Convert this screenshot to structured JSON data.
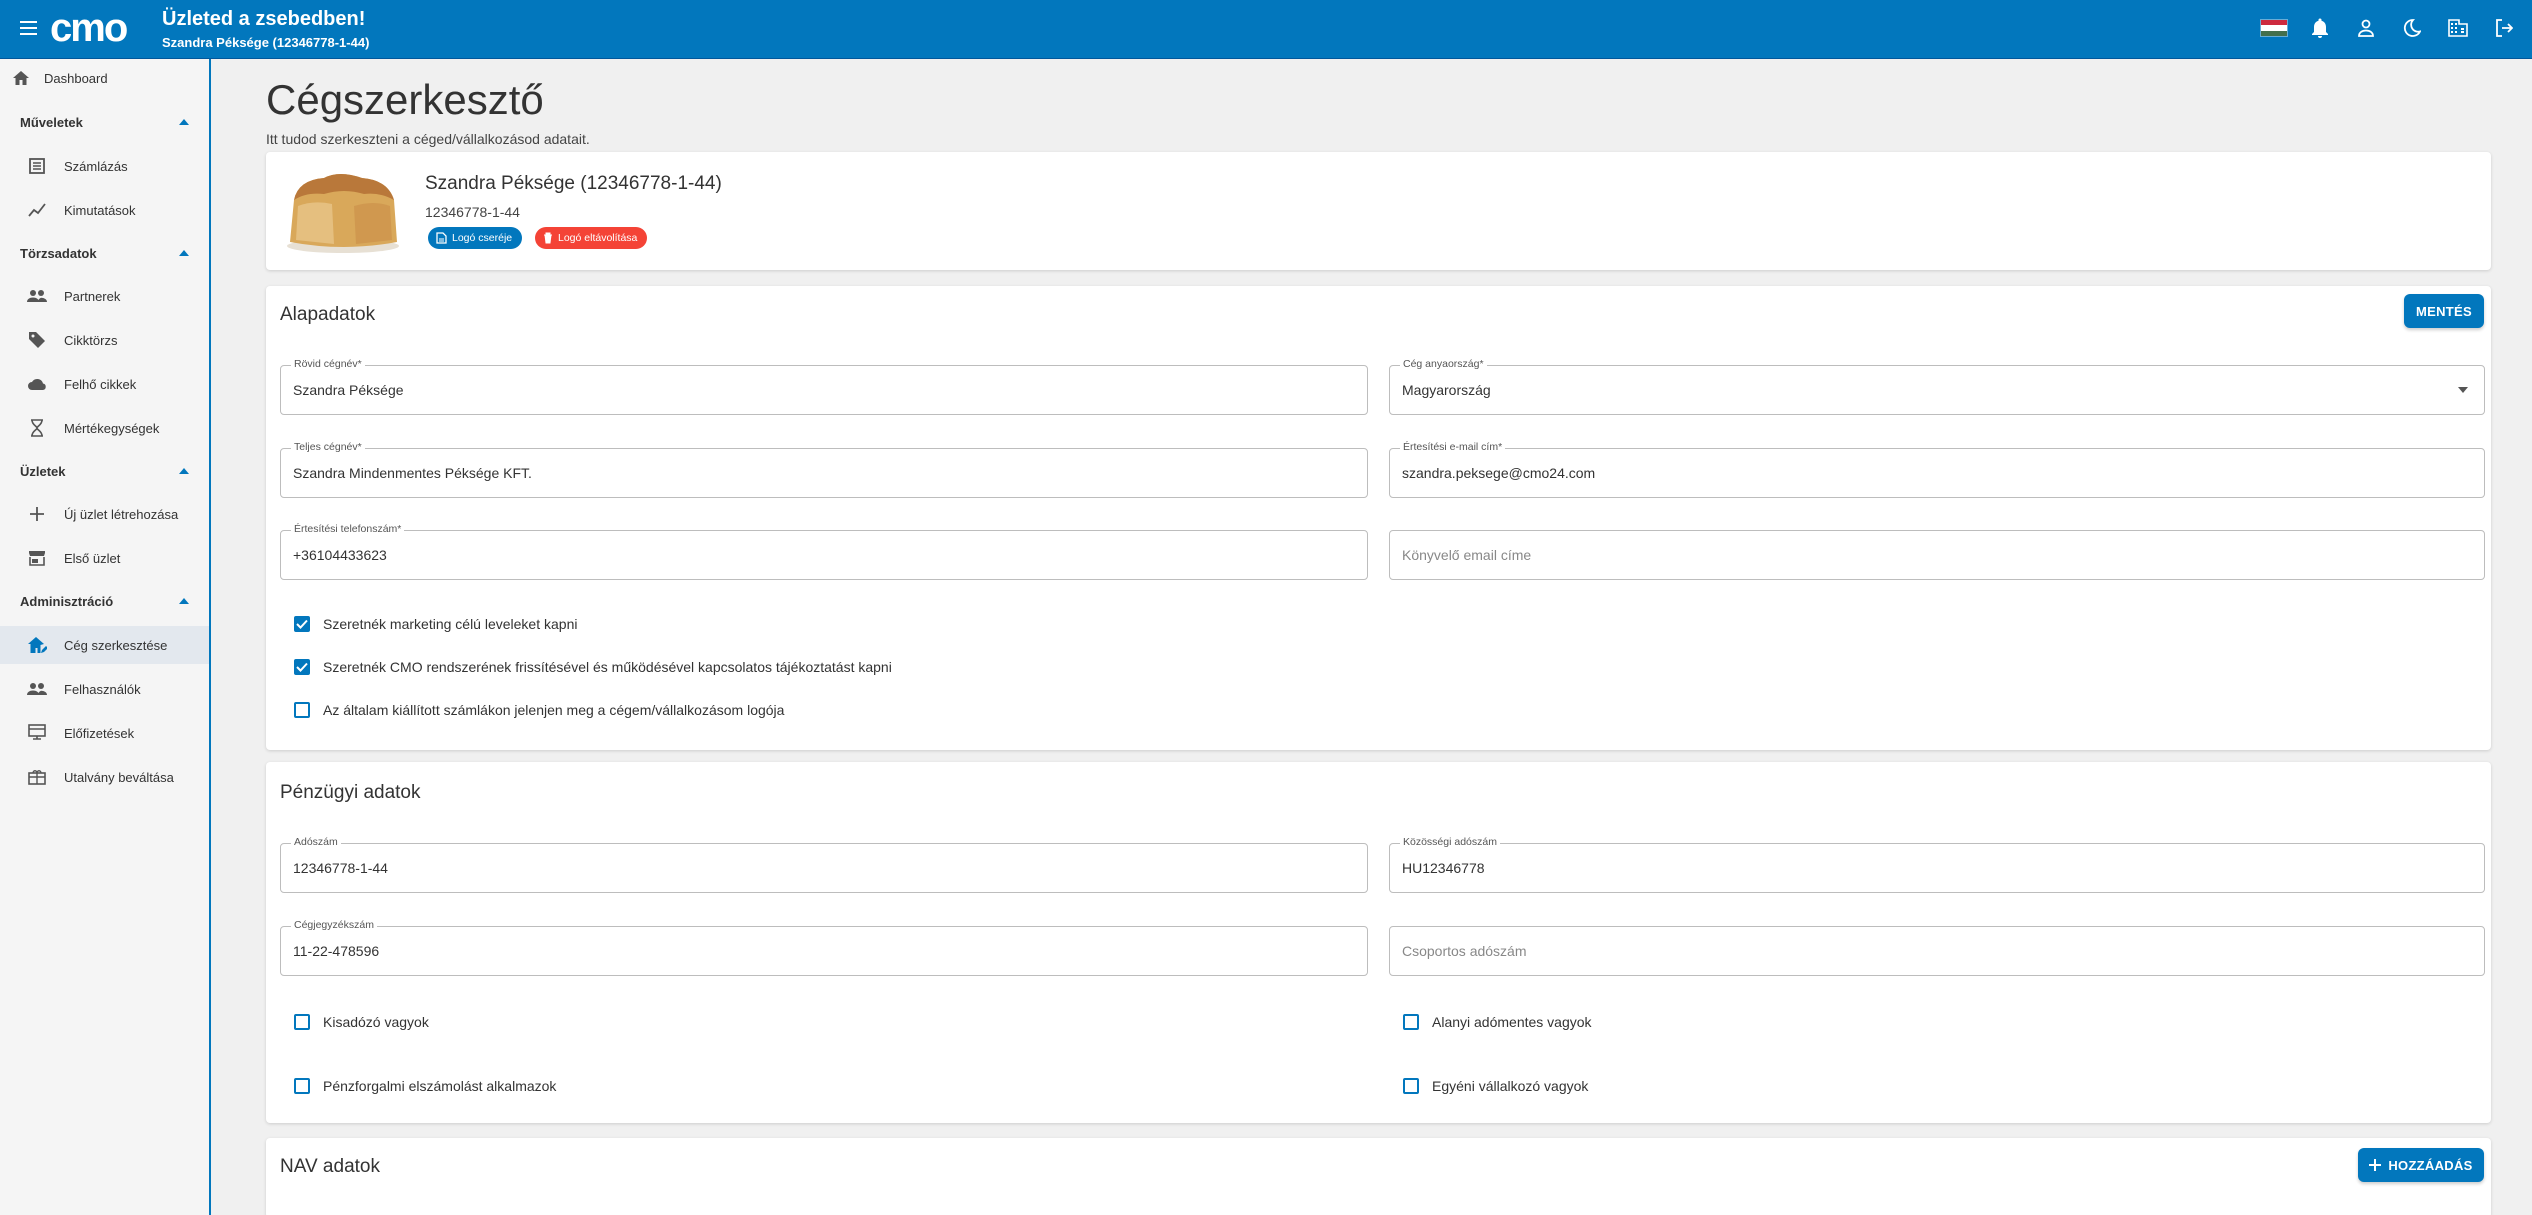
{
  "header": {
    "logo_text": "cmo",
    "shop_title": "Üzleted a zsebedben!",
    "shop_subtitle": "Szandra Péksége (12346778-1-44)",
    "flag_colors": [
      "#cd2a3e",
      "#ffffff",
      "#436f4d"
    ]
  },
  "sidebar": {
    "dashboard": "Dashboard",
    "sections": {
      "muveletek": "Műveletek",
      "torzsadatok": "Törzsadatok",
      "uzletek": "Üzletek",
      "adminisztracio": "Adminisztráció"
    },
    "items": {
      "szamlazas": "Számlázás",
      "kimutatasok": "Kimutatások",
      "partnerek": "Partnerek",
      "cikktorzs": "Cikktörzs",
      "felho_cikkek": "Felhő cikkek",
      "mertekegysegek": "Mértékegységek",
      "uj_uzlet": "Új üzlet létrehozása",
      "elso_uzlet": "Első üzlet",
      "ceg_szerkesztese": "Cég szerkesztése",
      "felhasznalok": "Felhasználók",
      "elofizetesek": "Előfizetések",
      "utalvany": "Utalvány beváltása"
    }
  },
  "page": {
    "title": "Cégszerkesztő",
    "description": "Itt tudod szerkeszteni a céged/vállalkozásod adatait."
  },
  "company_card": {
    "name": "Szandra Péksége (12346778-1-44)",
    "tax_number": "12346778-1-44",
    "change_logo": "Logó cseréje",
    "remove_logo": "Logó eltávolítása"
  },
  "basic": {
    "title": "Alapadatok",
    "save": "MENTÉS",
    "short_name_label": "Rövid cégnév*",
    "short_name": "Szandra Péksége",
    "country_label": "Cég anyaország*",
    "country": "Magyarország",
    "full_name_label": "Teljes cégnév*",
    "full_name": "Szandra Mindenmentes Péksége KFT.",
    "email_label": "Értesítési e-mail cím*",
    "email": "szandra.peksege@cmo24.com",
    "phone_label": "Értesítési telefonszám*",
    "phone": "+36104433623",
    "accountant_placeholder": "Könyvelő email címe",
    "checks": [
      {
        "label": "Szeretnék marketing célú leveleket kapni",
        "checked": true
      },
      {
        "label": "Szeretnék CMO rendszerének frissítésével és működésével kapcsolatos tájékoztatást kapni",
        "checked": true
      },
      {
        "label": "Az általam kiállított számlákon jelenjen meg a cégem/vállalkozásom logója",
        "checked": false
      }
    ]
  },
  "finance": {
    "title": "Pénzügyi adatok",
    "tax_label": "Adószám",
    "tax": "12346778-1-44",
    "eu_tax_label": "Közösségi adószám",
    "eu_tax": "HU12346778",
    "reg_label": "Cégjegyzékszám",
    "reg": "11-22-478596",
    "group_tax_placeholder": "Csoportos adószám",
    "checks": [
      {
        "label": "Kisadózó vagyok",
        "checked": false
      },
      {
        "label": "Alanyi adómentes vagyok",
        "checked": false
      },
      {
        "label": "Pénzforgalmi elszámolást alkalmazok",
        "checked": false
      },
      {
        "label": "Egyéni vállalkozó vagyok",
        "checked": false
      }
    ]
  },
  "nav": {
    "title": "NAV adatok",
    "add": "HOZZÁADÁS"
  },
  "colors": {
    "primary": "#0277bd",
    "danger": "#f44336",
    "sidebar_bg": "#f5f5f5",
    "page_bg": "#f0f0f0"
  }
}
